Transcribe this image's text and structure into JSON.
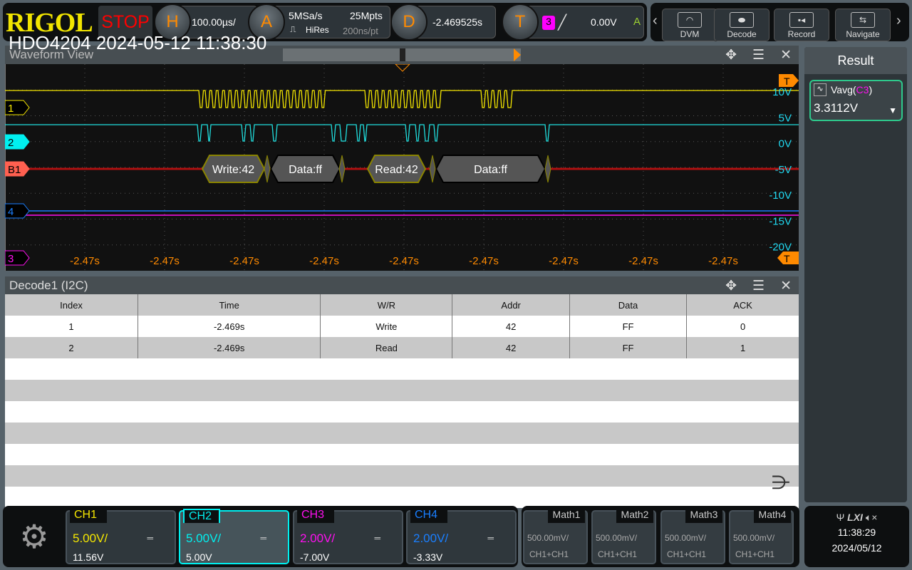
{
  "header": {
    "logo": "RIGOL",
    "run_state": "STOP",
    "horizontal": {
      "label": "H",
      "scale": "100.00µs/"
    },
    "acquire": {
      "label": "A",
      "sample_rate": "5MSa/s",
      "memory_depth": "25Mpts",
      "mode": "HiRes",
      "time_per_point": "200ns/pt"
    },
    "delay": {
      "label": "D",
      "value": "-2.469525s"
    },
    "trigger": {
      "label": "T",
      "source": "3",
      "level": "0.00V",
      "mode": "A"
    },
    "overlay_title": "HDO4204 2024-05-12 11:38:30"
  },
  "tools": [
    {
      "label": "DVM",
      "icon": "dvm-icon"
    },
    {
      "label": "Decode",
      "icon": "decode-icon"
    },
    {
      "label": "Record",
      "icon": "record-icon"
    },
    {
      "label": "Navigate",
      "icon": "navigate-icon"
    }
  ],
  "waveform_view": {
    "title": "Waveform View",
    "time_labels": [
      "-2.47s",
      "-2.47s",
      "-2.47s",
      "-2.47s",
      "-2.47s",
      "-2.47s",
      "-2.47s",
      "-2.47s",
      "-2.47s"
    ],
    "volt_labels": [
      "10V",
      "5V",
      "0V",
      "-5V",
      "-10V",
      "-15V",
      "-20V"
    ],
    "channel_markers": [
      "1",
      "2",
      "B1",
      "4",
      "3"
    ],
    "trigger_marker": "T",
    "decode_frames": [
      "Write:42",
      "Data:ff",
      "Read:42",
      "Data:ff"
    ]
  },
  "decode_table": {
    "title": "Decode1 (I2C)",
    "columns": [
      "Index",
      "Time",
      "W/R",
      "Addr",
      "Data",
      "ACK"
    ],
    "rows": [
      [
        "1",
        "-2.469s",
        "Write",
        "42",
        "FF",
        "0"
      ],
      [
        "2",
        "-2.469s",
        "Read",
        "42",
        "FF",
        "1"
      ]
    ]
  },
  "result": {
    "title": "Result",
    "measurement": "Vavg(",
    "source": "C3",
    "close": ")",
    "value": "3.3112V"
  },
  "channels": [
    {
      "name": "CH1",
      "scale": "5.00V/",
      "offset": "11.56V",
      "color": "#f5e700"
    },
    {
      "name": "CH2",
      "scale": "5.00V/",
      "offset": "5.00V",
      "color": "#00f0f0"
    },
    {
      "name": "CH3",
      "scale": "2.00V/",
      "offset": "-7.00V",
      "color": "#ff10f0"
    },
    {
      "name": "CH4",
      "scale": "2.00V/",
      "offset": "-3.33V",
      "color": "#1a7fff"
    }
  ],
  "math": [
    {
      "name": "Math1",
      "scale": "500.00mV/",
      "expr": "CH1+CH1"
    },
    {
      "name": "Math2",
      "scale": "500.00mV/",
      "expr": "CH1+CH1"
    },
    {
      "name": "Math3",
      "scale": "500.00mV/",
      "expr": "CH1+CH1"
    },
    {
      "name": "Math4",
      "scale": "500.00mV/",
      "expr": "CH1+CH1"
    }
  ],
  "status": {
    "lxi": "LXI",
    "time": "11:38:29",
    "date": "2024/05/12"
  }
}
